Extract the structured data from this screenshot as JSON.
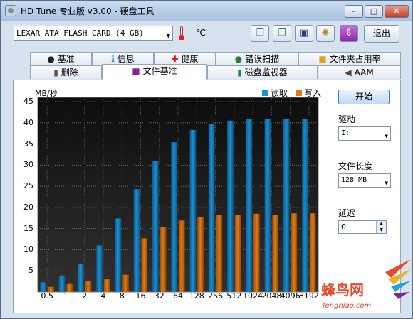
{
  "window": {
    "title": "HD Tune 专业版 v3.00 - 硬盘工具",
    "minimize": "–",
    "maximize": "□",
    "close": "✕"
  },
  "toolbar": {
    "drive": "LEXAR ATA FLASH CARD (4 GB)",
    "temperature": "-- ℃",
    "buttons": [
      "copy-info",
      "copy-screen",
      "save",
      "options",
      "download"
    ],
    "exit_label": "退出"
  },
  "tabs_row1": [
    {
      "label": "基准",
      "icon": "benchmark-icon",
      "glyph": "●"
    },
    {
      "label": "信息",
      "icon": "info-icon",
      "glyph": "ℹ"
    },
    {
      "label": "健康",
      "icon": "health-cross-icon",
      "glyph": "✚"
    },
    {
      "label": "错误扫描",
      "icon": "magnifier-icon",
      "glyph": "●"
    },
    {
      "label": "文件夹占用率",
      "icon": "folder-icon",
      "glyph": "■"
    }
  ],
  "tabs_row2": [
    {
      "label": "删除",
      "icon": "trash-icon",
      "glyph": "▮"
    },
    {
      "label": "文件基准",
      "icon": "file-benchmark-icon",
      "glyph": "■",
      "active": true
    },
    {
      "label": "磁盘监视器",
      "icon": "monitor-icon",
      "glyph": "▮"
    },
    {
      "label": "AAM",
      "icon": "speaker-icon",
      "glyph": "◀"
    }
  ],
  "side": {
    "start_label": "开始",
    "drive_label": "驱动",
    "drive_value": "I:",
    "file_length_label": "文件长度",
    "file_length_value": "128 MB",
    "delay_label": "延迟",
    "delay_value": "0"
  },
  "watermark": {
    "text": "蜂鸟网",
    "url": "fengniao.com"
  },
  "colors": {
    "read": "#1a8fd0",
    "write": "#e07b12",
    "plot_bg_top": "#0d0d0d",
    "plot_bg_bottom": "#303030"
  },
  "chart_data": {
    "type": "bar",
    "ylabel": "MB/秒",
    "ylim": [
      0,
      45
    ],
    "yticks": [
      5,
      10,
      15,
      20,
      25,
      30,
      35,
      40,
      45
    ],
    "categories": [
      "0.5",
      "1",
      "2",
      "4",
      "8",
      "16",
      "32",
      "64",
      "128",
      "256",
      "512",
      "1024",
      "2048",
      "4096",
      "8192"
    ],
    "series": [
      {
        "name": "读取",
        "values": [
          2.3,
          3.9,
          6.6,
          11.0,
          17.4,
          24.3,
          30.9,
          35.4,
          38.3,
          39.8,
          40.5,
          40.8,
          40.8,
          40.9,
          40.9
        ]
      },
      {
        "name": "写入",
        "values": [
          1.2,
          1.9,
          2.7,
          3.0,
          4.1,
          12.7,
          15.3,
          16.9,
          17.7,
          18.3,
          18.3,
          18.5,
          18.3,
          18.6,
          18.6
        ]
      }
    ],
    "legend": "top-right",
    "grid": true
  }
}
